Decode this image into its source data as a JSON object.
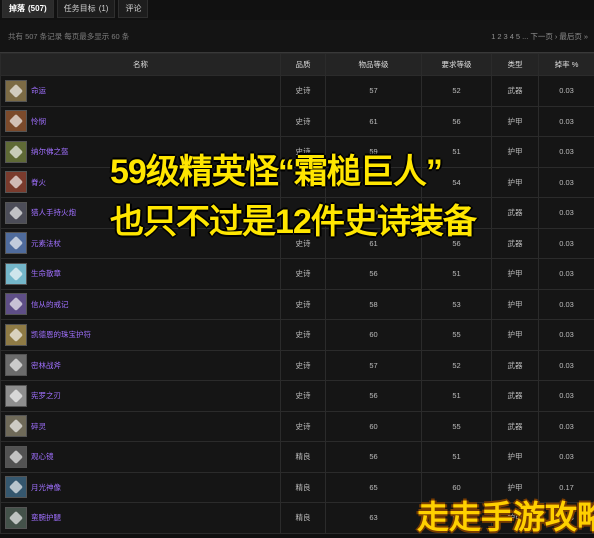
{
  "tabs": [
    {
      "label": "掉落",
      "count": "(507)",
      "active": true
    },
    {
      "label": "任务目标",
      "count": "(1)",
      "active": false
    },
    {
      "label": "评论",
      "count": "",
      "active": false
    }
  ],
  "listing": {
    "total_text": "共有 507 条记录  每页最多显示 60 条",
    "pager": [
      "1",
      "2",
      "3",
      "4",
      "5",
      "...",
      "下一页",
      "›",
      "最后页",
      "»"
    ]
  },
  "headers": [
    "名称",
    "品质",
    "物品等级",
    "要求等级",
    "类型",
    "掉率 %"
  ],
  "rows": [
    {
      "name": "命运",
      "quality": "史诗",
      "ilvl": "57",
      "req": "52",
      "type": "武器",
      "drop": "0.03",
      "icon_color": "#7c6b45",
      "icon_name": "axe-icon"
    },
    {
      "name": "怜悯",
      "quality": "史诗",
      "ilvl": "61",
      "req": "56",
      "type": "护甲",
      "drop": "0.03",
      "icon_color": "#7b4a2b",
      "icon_name": "boot-icon"
    },
    {
      "name": "纳尔佛之盔",
      "quality": "史诗",
      "ilvl": "59",
      "req": "51",
      "type": "护甲",
      "drop": "0.03",
      "icon_color": "#5f6a36",
      "icon_name": "helm-icon"
    },
    {
      "name": "脊火",
      "quality": "史诗",
      "ilvl": "59",
      "req": "54",
      "type": "护甲",
      "drop": "0.03",
      "icon_color": "#7a3b2d",
      "icon_name": "armor-icon"
    },
    {
      "name": "猎人手持火炮",
      "quality": "史诗",
      "ilvl": "59",
      "req": "53",
      "type": "武器",
      "drop": "0.03",
      "icon_color": "#4c4d58",
      "icon_name": "gun-icon"
    },
    {
      "name": "元素法杖",
      "quality": "史诗",
      "ilvl": "61",
      "req": "56",
      "type": "武器",
      "drop": "0.03",
      "icon_color": "#4f6b9c",
      "icon_name": "staff-icon"
    },
    {
      "name": "生命散章",
      "quality": "史诗",
      "ilvl": "56",
      "req": "51",
      "type": "护甲",
      "drop": "0.03",
      "icon_color": "#74b6c9",
      "icon_name": "gem-icon"
    },
    {
      "name": "信从的戒记",
      "quality": "史诗",
      "ilvl": "58",
      "req": "53",
      "type": "护甲",
      "drop": "0.03",
      "icon_color": "#5e4e86",
      "icon_name": "ring-icon"
    },
    {
      "name": "凯德恩的珠宝护符",
      "quality": "史诗",
      "ilvl": "60",
      "req": "55",
      "type": "护甲",
      "drop": "0.03",
      "icon_color": "#8f7b45",
      "icon_name": "amulet-icon"
    },
    {
      "name": "密林战斧",
      "quality": "史诗",
      "ilvl": "57",
      "req": "52",
      "type": "武器",
      "drop": "0.03",
      "icon_color": "#6b6b6b",
      "icon_name": "battleaxe-icon"
    },
    {
      "name": "宪罗之刃",
      "quality": "史诗",
      "ilvl": "56",
      "req": "51",
      "type": "武器",
      "drop": "0.03",
      "icon_color": "#8d8d8d",
      "icon_name": "blade-icon"
    },
    {
      "name": "碎灵",
      "quality": "史诗",
      "ilvl": "60",
      "req": "55",
      "type": "武器",
      "drop": "0.03",
      "icon_color": "#6f6a59",
      "icon_name": "polearm-icon"
    },
    {
      "name": "观心镜",
      "quality": "精良",
      "ilvl": "56",
      "req": "51",
      "type": "护甲",
      "drop": "0.03",
      "icon_color": "#525252",
      "icon_name": "mirror-icon"
    },
    {
      "name": "月光神像",
      "quality": "精良",
      "ilvl": "65",
      "req": "60",
      "type": "护甲",
      "drop": "0.17",
      "icon_color": "#35576e",
      "icon_name": "idol-icon"
    },
    {
      "name": "蛮腕护腿",
      "quality": "精良",
      "ilvl": "63",
      "req": "58",
      "type": "护甲",
      "drop": "0.03",
      "icon_color": "#44524a",
      "icon_name": "legs-icon"
    }
  ],
  "overlay": {
    "line1": "59级精英怪“霜槌巨人”",
    "line2": "也只不过是12件史诗装备",
    "watermark": "走走手游攻略"
  }
}
